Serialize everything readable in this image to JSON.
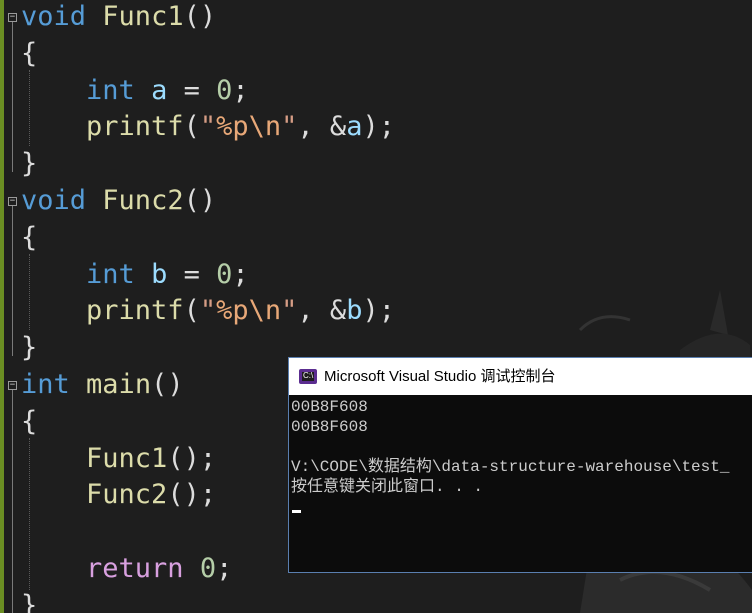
{
  "editor": {
    "lines": [
      [
        [
          "kw",
          "void"
        ],
        [
          "punc",
          " "
        ],
        [
          "fn",
          "Func1"
        ],
        [
          "punc",
          "()"
        ]
      ],
      [
        [
          "punc",
          "{"
        ]
      ],
      [
        [
          "punc",
          "    "
        ],
        [
          "kw",
          "int"
        ],
        [
          "punc",
          " "
        ],
        [
          "var",
          "a"
        ],
        [
          "punc",
          " = "
        ],
        [
          "num",
          "0"
        ],
        [
          "punc",
          ";"
        ]
      ],
      [
        [
          "punc",
          "    "
        ],
        [
          "fn",
          "printf"
        ],
        [
          "punc",
          "("
        ],
        [
          "str",
          "\""
        ],
        [
          "fmt",
          "%p\\n"
        ],
        [
          "str",
          "\""
        ],
        [
          "punc",
          ", &"
        ],
        [
          "var",
          "a"
        ],
        [
          "punc",
          ");"
        ]
      ],
      [
        [
          "punc",
          "}"
        ]
      ],
      [
        [
          "kw",
          "void"
        ],
        [
          "punc",
          " "
        ],
        [
          "fn",
          "Func2"
        ],
        [
          "punc",
          "()"
        ]
      ],
      [
        [
          "punc",
          "{"
        ]
      ],
      [
        [
          "punc",
          "    "
        ],
        [
          "kw",
          "int"
        ],
        [
          "punc",
          " "
        ],
        [
          "var",
          "b"
        ],
        [
          "punc",
          " = "
        ],
        [
          "num",
          "0"
        ],
        [
          "punc",
          ";"
        ]
      ],
      [
        [
          "punc",
          "    "
        ],
        [
          "fn",
          "printf"
        ],
        [
          "punc",
          "("
        ],
        [
          "str",
          "\""
        ],
        [
          "fmt",
          "%p\\n"
        ],
        [
          "str",
          "\""
        ],
        [
          "punc",
          ", &"
        ],
        [
          "var",
          "b"
        ],
        [
          "punc",
          ");"
        ]
      ],
      [
        [
          "punc",
          "}"
        ]
      ],
      [
        [
          "kw",
          "int"
        ],
        [
          "punc",
          " "
        ],
        [
          "fn",
          "main"
        ],
        [
          "punc",
          "()"
        ]
      ],
      [
        [
          "punc",
          "{"
        ]
      ],
      [
        [
          "punc",
          "    "
        ],
        [
          "fn",
          "Func1"
        ],
        [
          "punc",
          "();"
        ]
      ],
      [
        [
          "punc",
          "    "
        ],
        [
          "fn",
          "Func2"
        ],
        [
          "punc",
          "();"
        ]
      ],
      [
        [
          "punc",
          ""
        ]
      ],
      [
        [
          "punc",
          "    "
        ],
        [
          "kw2",
          "return"
        ],
        [
          "punc",
          " "
        ],
        [
          "num",
          "0"
        ],
        [
          "punc",
          ";"
        ]
      ],
      [
        [
          "punc",
          "}"
        ]
      ]
    ],
    "fold_markers": [
      "⊟",
      "⊟",
      "⊟"
    ]
  },
  "console": {
    "title": "Microsoft Visual Studio 调试控制台",
    "icon_label": "C:\\",
    "output": [
      "00B8F608",
      "00B8F608",
      "",
      "V:\\CODE\\数据结构\\data-structure-warehouse\\test_",
      "按任意键关闭此窗口. . ."
    ]
  },
  "colors": {
    "keyword": "#569cd6",
    "control_keyword": "#d8a0df",
    "function": "#dcdcaa",
    "number": "#b5cea8",
    "string": "#d69d85",
    "variable": "#9cdcfe",
    "console_bg": "#0c0c0c",
    "titlebar_bg": "#ffffff"
  }
}
